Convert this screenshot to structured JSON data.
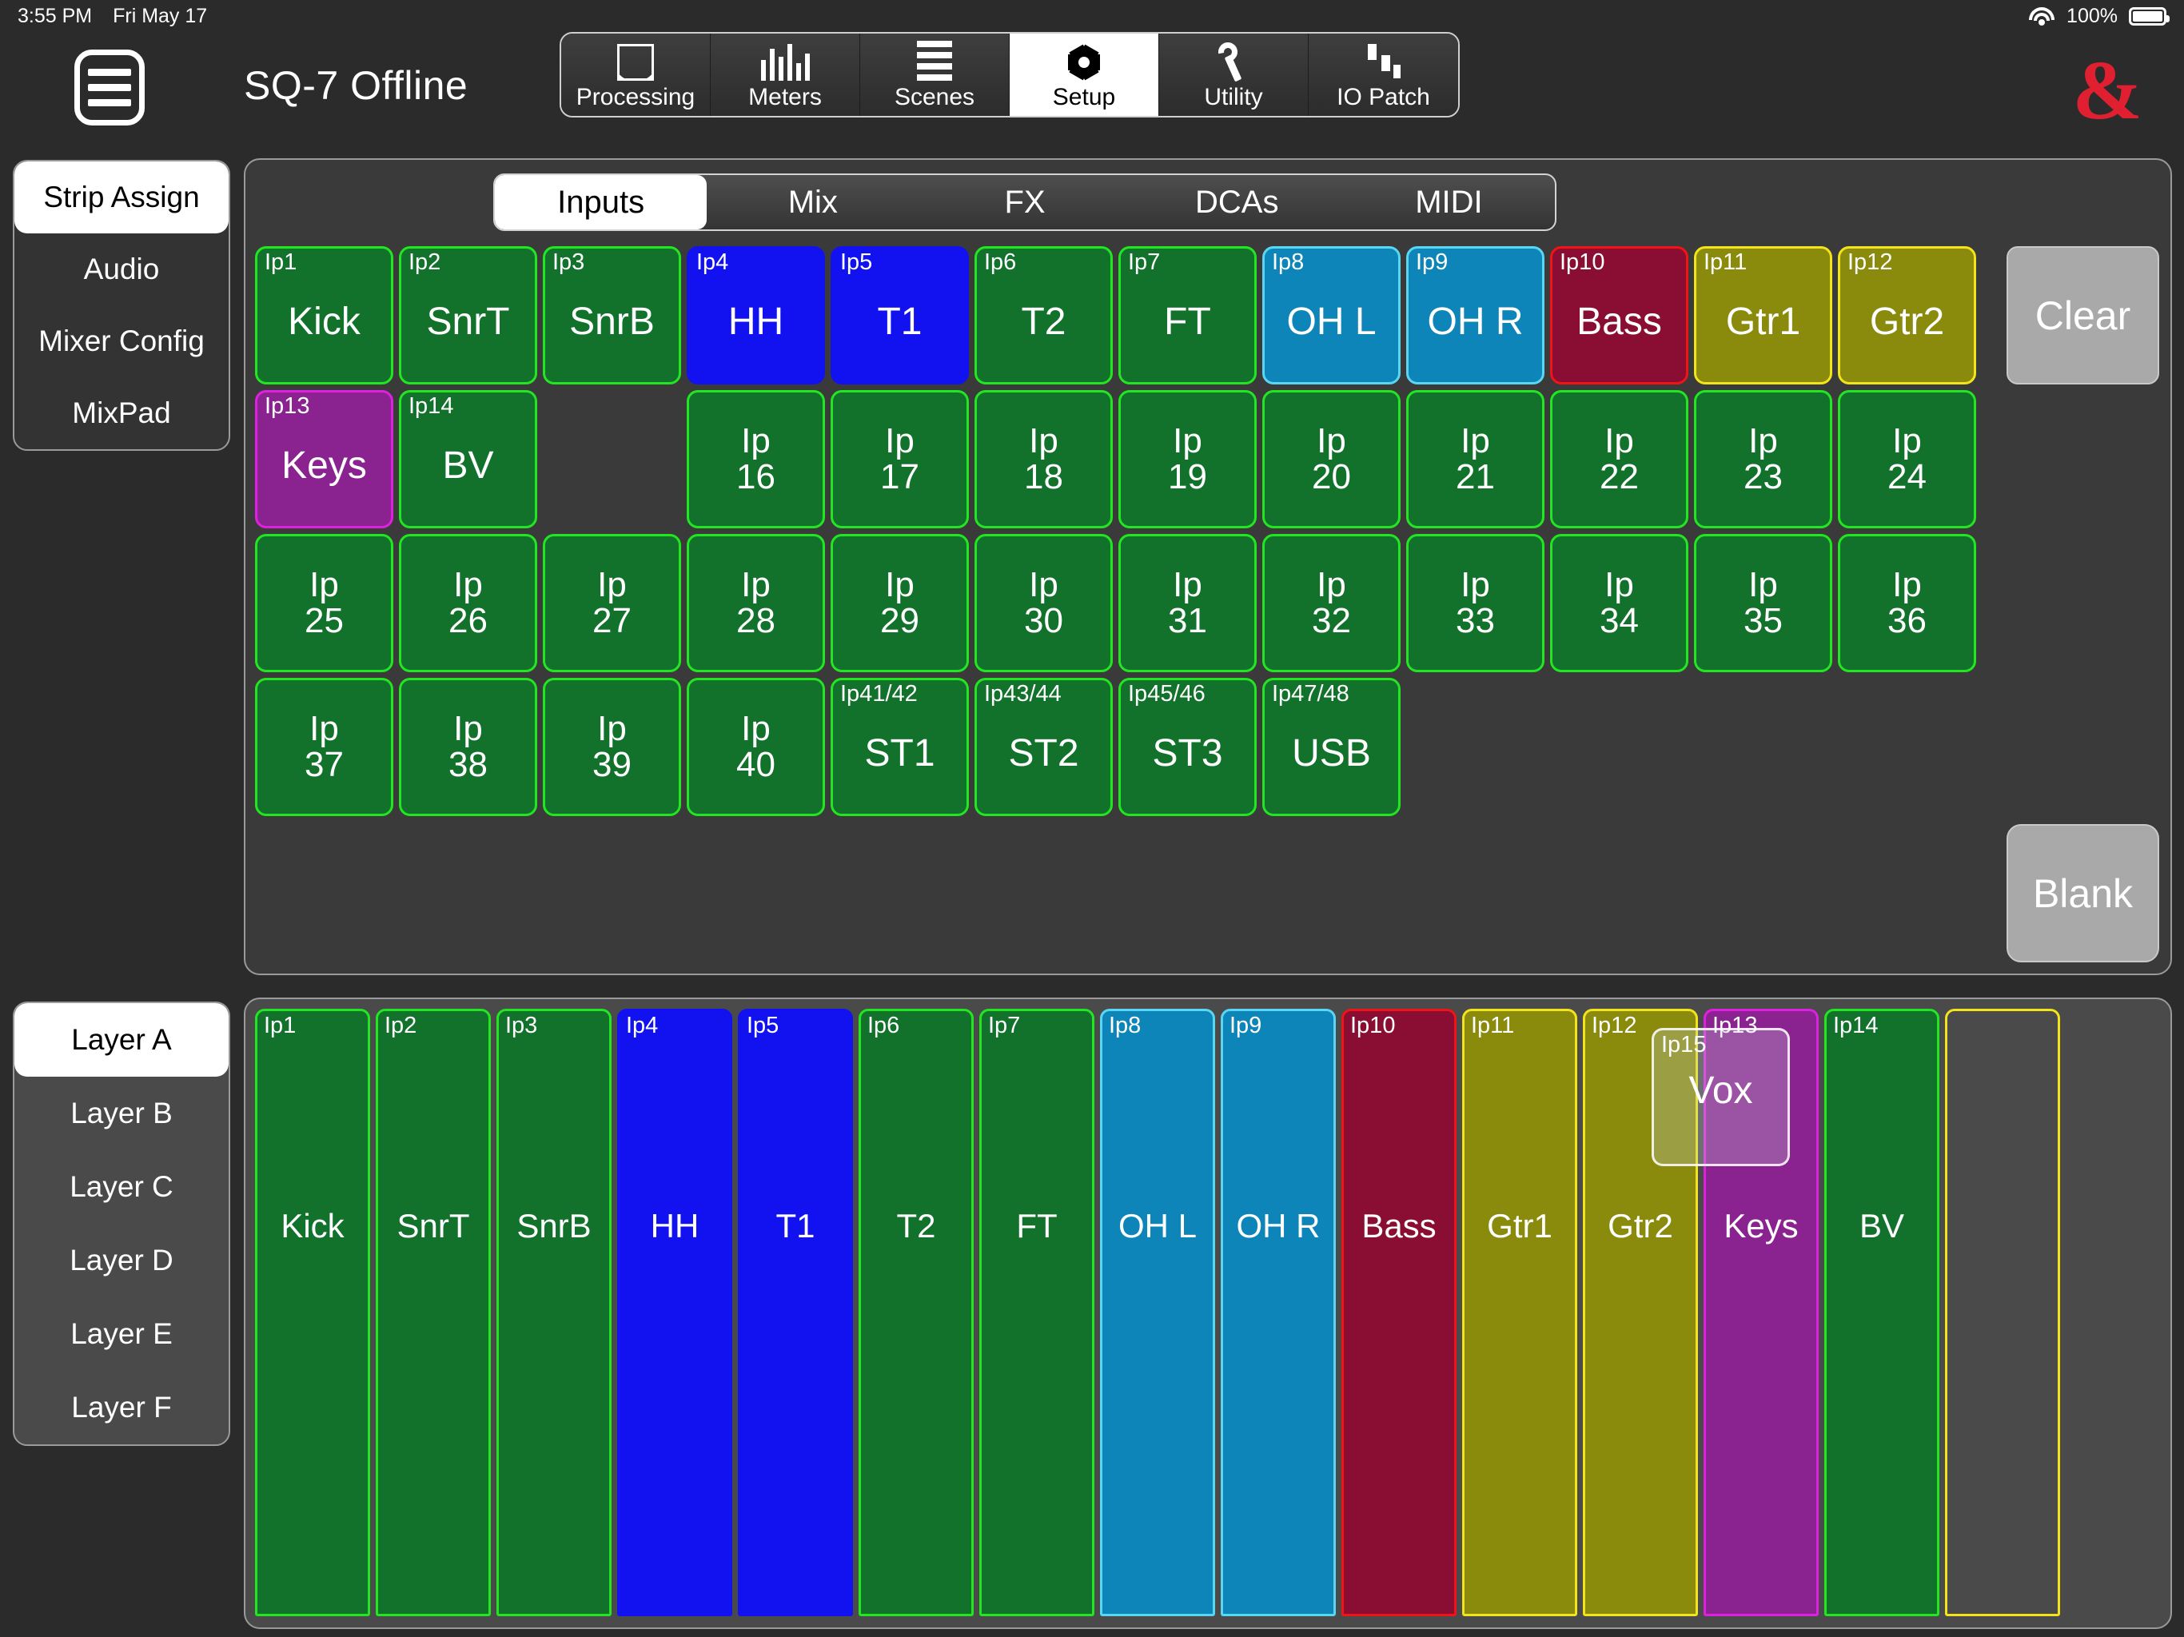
{
  "status_bar": {
    "time": "3:55 PM",
    "date": "Fri May 17",
    "battery_percent": "100%",
    "wifi_icon": "wifi-icon",
    "battery_icon": "battery-icon"
  },
  "header": {
    "title": "SQ-7 Offline",
    "menu_icon": "hamburger-menu-icon",
    "brand_logo": "ampersand-logo",
    "brand_text": "&",
    "brand_color": "#e02030"
  },
  "top_nav": {
    "items": [
      {
        "label": "Processing",
        "icon": "waveform-icon",
        "active": false
      },
      {
        "label": "Meters",
        "icon": "bar-meters-icon",
        "active": false
      },
      {
        "label": "Scenes",
        "icon": "list-lines-icon",
        "active": false
      },
      {
        "label": "Setup",
        "icon": "gear-icon",
        "active": true
      },
      {
        "label": "Utility",
        "icon": "wrench-icon",
        "active": false
      },
      {
        "label": "IO Patch",
        "icon": "patch-blocks-icon",
        "active": false
      }
    ]
  },
  "sidebar": {
    "items": [
      {
        "label": "Strip Assign",
        "active": true
      },
      {
        "label": "Audio",
        "active": false
      },
      {
        "label": "Mixer Config",
        "active": false
      },
      {
        "label": "MixPad",
        "active": false
      }
    ]
  },
  "main": {
    "tabs": [
      {
        "label": "Inputs",
        "active": true
      },
      {
        "label": "Mix",
        "active": false
      },
      {
        "label": "FX",
        "active": false
      },
      {
        "label": "DCAs",
        "active": false
      },
      {
        "label": "MIDI",
        "active": false
      }
    ],
    "clear_label": "Clear",
    "blank_label": "Blank",
    "colors": {
      "green": "#12722c",
      "green_border": "#22e622",
      "blue": "#1212f0",
      "blue_border": "#1212f0",
      "cyan": "#0e85b8",
      "cyan_border": "#58d6f2",
      "red": "#8a0e33",
      "red_border": "#f01414",
      "olive": "#8a8a0c",
      "olive_border": "#f2e31a",
      "purple": "#8a2390",
      "purple_border": "#e020e0",
      "grey": "#a9a9a9"
    },
    "grid_rows": [
      [
        {
          "idx": "Ip1",
          "name": "Kick",
          "color": "green"
        },
        {
          "idx": "Ip2",
          "name": "SnrT",
          "color": "green"
        },
        {
          "idx": "Ip3",
          "name": "SnrB",
          "color": "green"
        },
        {
          "idx": "Ip4",
          "name": "HH",
          "color": "blue"
        },
        {
          "idx": "Ip5",
          "name": "T1",
          "color": "blue"
        },
        {
          "idx": "Ip6",
          "name": "T2",
          "color": "green"
        },
        {
          "idx": "Ip7",
          "name": "FT",
          "color": "green"
        },
        {
          "idx": "Ip8",
          "name": "OH L",
          "color": "cyan"
        },
        {
          "idx": "Ip9",
          "name": "OH R",
          "color": "cyan"
        },
        {
          "idx": "Ip10",
          "name": "Bass",
          "color": "red"
        },
        {
          "idx": "Ip11",
          "name": "Gtr1",
          "color": "olive"
        },
        {
          "idx": "Ip12",
          "name": "Gtr2",
          "color": "olive"
        }
      ],
      [
        {
          "idx": "Ip13",
          "name": "Keys",
          "color": "purple"
        },
        {
          "idx": "Ip14",
          "name": "BV",
          "color": "green"
        },
        {
          "idx": "",
          "name": "",
          "color": "empty"
        },
        {
          "idx": "",
          "name": "Ip\n16",
          "color": "green",
          "numeric": true
        },
        {
          "idx": "",
          "name": "Ip\n17",
          "color": "green",
          "numeric": true
        },
        {
          "idx": "",
          "name": "Ip\n18",
          "color": "green",
          "numeric": true
        },
        {
          "idx": "",
          "name": "Ip\n19",
          "color": "green",
          "numeric": true
        },
        {
          "idx": "",
          "name": "Ip\n20",
          "color": "green",
          "numeric": true
        },
        {
          "idx": "",
          "name": "Ip\n21",
          "color": "green",
          "numeric": true
        },
        {
          "idx": "",
          "name": "Ip\n22",
          "color": "green",
          "numeric": true
        },
        {
          "idx": "",
          "name": "Ip\n23",
          "color": "green",
          "numeric": true
        },
        {
          "idx": "",
          "name": "Ip\n24",
          "color": "green",
          "numeric": true
        }
      ],
      [
        {
          "idx": "",
          "name": "Ip\n25",
          "color": "green",
          "numeric": true
        },
        {
          "idx": "",
          "name": "Ip\n26",
          "color": "green",
          "numeric": true
        },
        {
          "idx": "",
          "name": "Ip\n27",
          "color": "green",
          "numeric": true
        },
        {
          "idx": "",
          "name": "Ip\n28",
          "color": "green",
          "numeric": true
        },
        {
          "idx": "",
          "name": "Ip\n29",
          "color": "green",
          "numeric": true
        },
        {
          "idx": "",
          "name": "Ip\n30",
          "color": "green",
          "numeric": true
        },
        {
          "idx": "",
          "name": "Ip\n31",
          "color": "green",
          "numeric": true
        },
        {
          "idx": "",
          "name": "Ip\n32",
          "color": "green",
          "numeric": true
        },
        {
          "idx": "",
          "name": "Ip\n33",
          "color": "green",
          "numeric": true
        },
        {
          "idx": "",
          "name": "Ip\n34",
          "color": "green",
          "numeric": true
        },
        {
          "idx": "",
          "name": "Ip\n35",
          "color": "green",
          "numeric": true
        },
        {
          "idx": "",
          "name": "Ip\n36",
          "color": "green",
          "numeric": true
        }
      ],
      [
        {
          "idx": "",
          "name": "Ip\n37",
          "color": "green",
          "numeric": true
        },
        {
          "idx": "",
          "name": "Ip\n38",
          "color": "green",
          "numeric": true
        },
        {
          "idx": "",
          "name": "Ip\n39",
          "color": "green",
          "numeric": true
        },
        {
          "idx": "",
          "name": "Ip\n40",
          "color": "green",
          "numeric": true
        },
        {
          "idx": "Ip41/42",
          "name": "ST1",
          "color": "green"
        },
        {
          "idx": "Ip43/44",
          "name": "ST2",
          "color": "green"
        },
        {
          "idx": "Ip45/46",
          "name": "ST3",
          "color": "green"
        },
        {
          "idx": "Ip47/48",
          "name": "USB",
          "color": "green"
        }
      ]
    ]
  },
  "layers": {
    "items": [
      {
        "label": "Layer A",
        "active": true
      },
      {
        "label": "Layer B",
        "active": false
      },
      {
        "label": "Layer C",
        "active": false
      },
      {
        "label": "Layer D",
        "active": false
      },
      {
        "label": "Layer E",
        "active": false
      },
      {
        "label": "Layer F",
        "active": false
      }
    ]
  },
  "strips": [
    {
      "idx": "Ip1",
      "name": "Kick",
      "color": "green"
    },
    {
      "idx": "Ip2",
      "name": "SnrT",
      "color": "green"
    },
    {
      "idx": "Ip3",
      "name": "SnrB",
      "color": "green"
    },
    {
      "idx": "Ip4",
      "name": "HH",
      "color": "blue"
    },
    {
      "idx": "Ip5",
      "name": "T1",
      "color": "blue"
    },
    {
      "idx": "Ip6",
      "name": "T2",
      "color": "green"
    },
    {
      "idx": "Ip7",
      "name": "FT",
      "color": "green"
    },
    {
      "idx": "Ip8",
      "name": "OH L",
      "color": "cyan"
    },
    {
      "idx": "Ip9",
      "name": "OH R",
      "color": "cyan"
    },
    {
      "idx": "Ip10",
      "name": "Bass",
      "color": "red"
    },
    {
      "idx": "Ip11",
      "name": "Gtr1",
      "color": "olive"
    },
    {
      "idx": "Ip12",
      "name": "Gtr2",
      "color": "olive"
    },
    {
      "idx": "Ip13",
      "name": "Keys",
      "color": "purple"
    },
    {
      "idx": "Ip14",
      "name": "BV",
      "color": "green"
    },
    {
      "idx": "",
      "name": "",
      "color": "empty"
    }
  ],
  "drag_tile": {
    "idx": "Ip15",
    "name": "Vox"
  }
}
